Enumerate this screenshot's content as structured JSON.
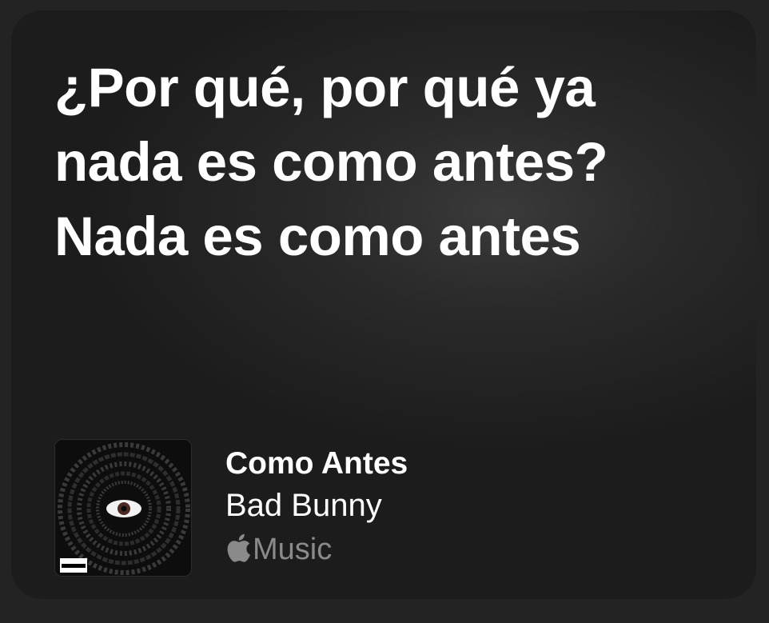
{
  "lyrics": {
    "line1": "¿Por qué, por qué ya nada es como antes?",
    "line2": "Nada es como antes"
  },
  "track": {
    "title": "Como Antes",
    "artist": "Bad Bunny",
    "service": "Music",
    "service_icon": "apple-logo-icon",
    "album_art": {
      "advisory_label": "PARENTAL ADVISORY",
      "advisory_sub": "EXPLICIT CONTENT"
    }
  },
  "colors": {
    "background": "#232323",
    "card": "#1c1c1c",
    "text": "#ffffff",
    "secondary": "#8a8a8a"
  }
}
